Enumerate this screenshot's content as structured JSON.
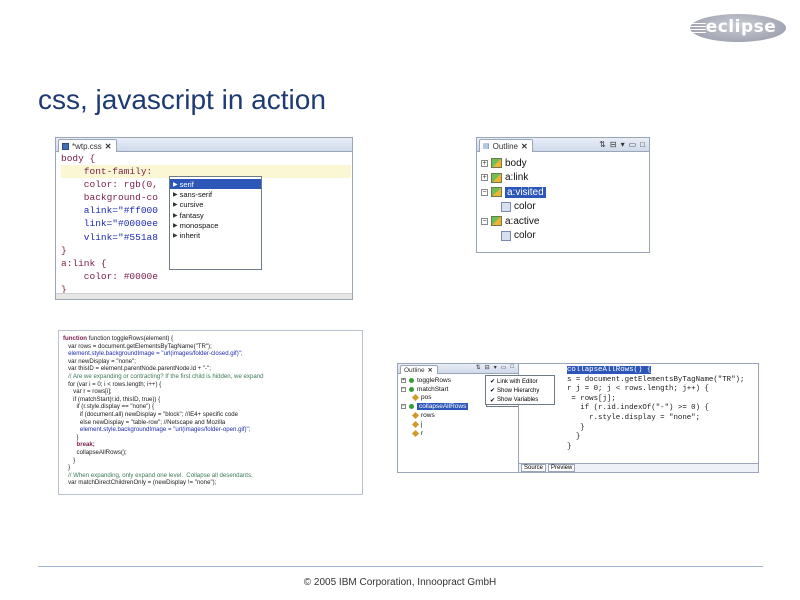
{
  "logo": {
    "text": "eclipse"
  },
  "title": "css, javascript in action",
  "css_editor": {
    "tab": "*wtp.css",
    "lines": [
      "body {",
      "    font-family:",
      "    color: rgb(0,",
      "    background-co",
      "    alink=\"#ff000",
      "    link=\"#0000ee",
      "    vlink=\"#551a8",
      "}",
      "",
      "a:link {",
      "    color: #0000e",
      "}"
    ],
    "completions": [
      "serif",
      "sans-serif",
      "cursive",
      "fantasy",
      "monospace",
      "inherit"
    ]
  },
  "outline": {
    "tab": "Outline",
    "items": [
      {
        "label": "body",
        "expanded": false
      },
      {
        "label": "a:link",
        "expanded": false
      },
      {
        "label": "a:visited",
        "expanded": true,
        "selected": true
      },
      {
        "label": "color",
        "child": true
      },
      {
        "label": "a:active",
        "expanded": true
      },
      {
        "label": "color",
        "child": true
      }
    ]
  },
  "js_editor": {
    "lines": [
      "function toggleRows(element) {",
      "   var rows = document.getElementsByTagName(\"TR\");",
      "   element.style.backgroundImage = \"url(images/folder-closed.gif)\";",
      "   var newDisplay = \"none\";",
      "   var thisID = element.parentNode.parentNode.id + \"-\";",
      "   // Are we expanding or contracting? If the first child is hidden, we expand",
      "   for (var i = 0; i < rows.length; i++) {",
      "      var r = rows[i];",
      "",
      "      if (matchStart(r.id, thisID, true)) {",
      "        if (r.style.display == \"none\") {",
      "          if (document.all) newDisplay = \"block\"; //IE4+ specific code",
      "          else newDisplay = \"table-row\"; //Netscape and Mozilla",
      "          element.style.backgroundImage = \"url(images/folder-open.gif)\";",
      "        }",
      "        break;",
      "        collapseAllRows();",
      "      }",
      "   }",
      "",
      "   // When expanding, only expand one level.  Collapse all desendants.",
      "   var matchDirectChildrenOnly = (newDisplay != \"none\");"
    ]
  },
  "js_outline": {
    "tab": "Outline",
    "items": [
      "toggleRows",
      "matchStart",
      "pos",
      "collapseAllRows",
      "rows",
      "j",
      "r"
    ],
    "menu": [
      "Link with Editor",
      "Show Hierarchy",
      "Show Variables"
    ],
    "code": [
      "collapseAllRows() {",
      "s = document.getElementsByTagName(\"TR\");",
      "r j = 0; j < rows.length; j++) {",
      " = rows[j];",
      "   if (r.id.indexOf(\"-\") >= 0) {",
      "     r.style.display = \"none\";",
      "   }",
      "  }",
      "}"
    ],
    "tabs": [
      "Source",
      "Preview"
    ]
  },
  "footer": "© 2005 IBM Corporation, Innoopract GmbH"
}
